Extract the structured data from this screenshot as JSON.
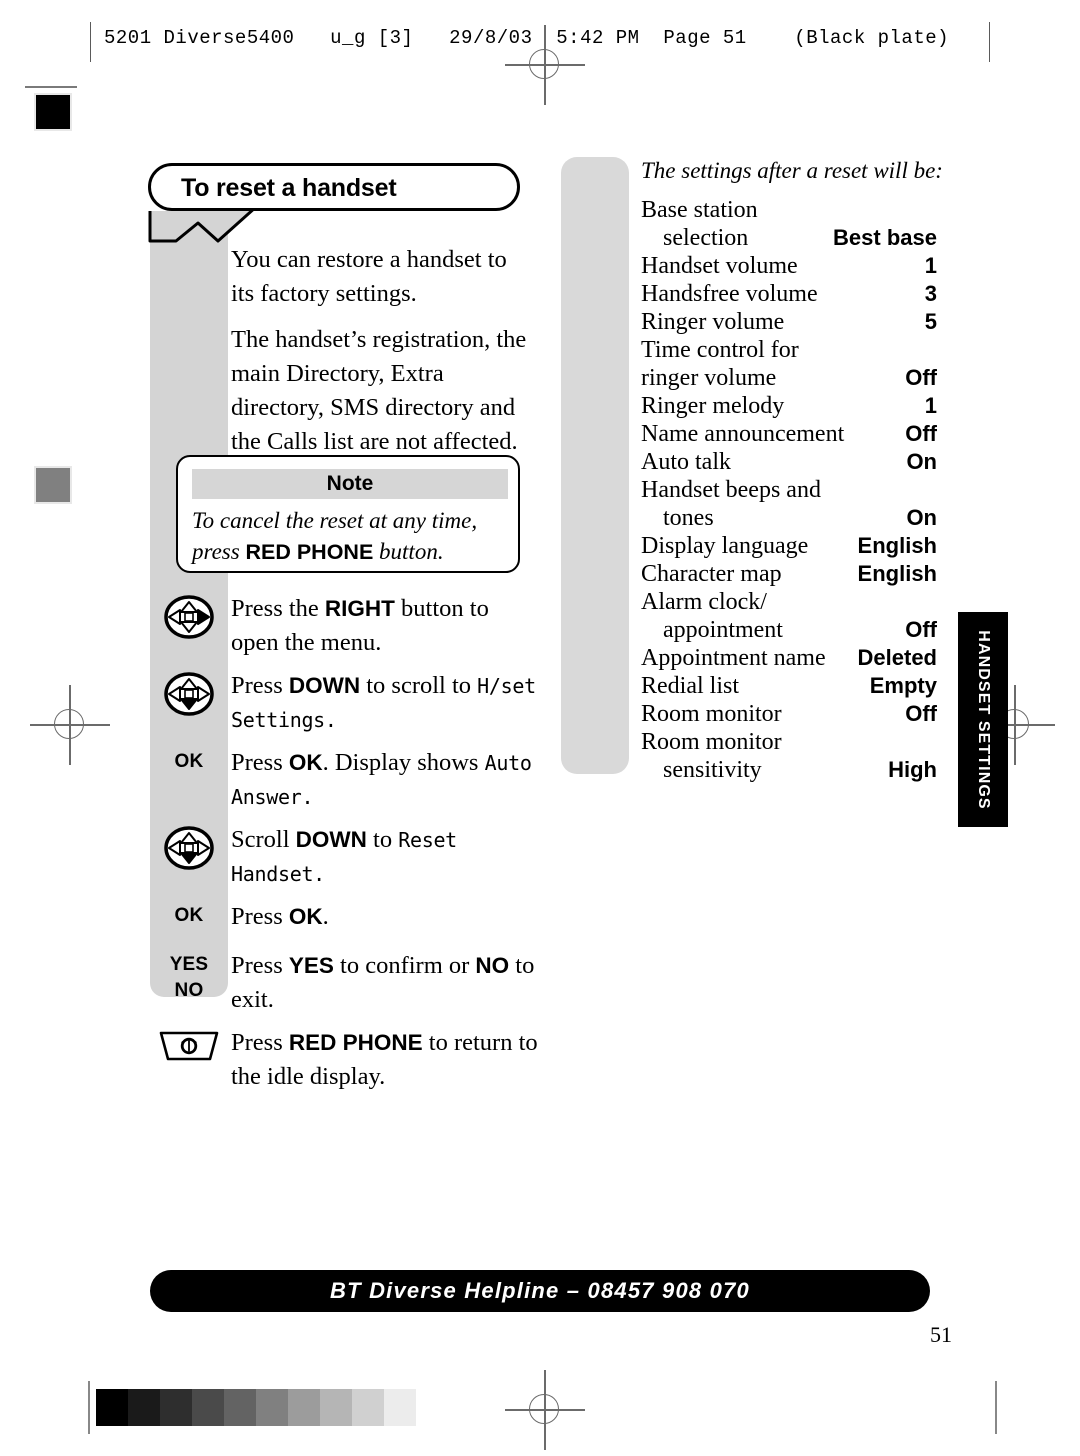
{
  "print_header": {
    "text": "5201 Diverse5400   u_g [3]   29/8/03  5:42 PM  Page 51    (Black plate)"
  },
  "title": {
    "heading": "To reset a handset"
  },
  "intro": {
    "paragraph1": "You can restore a handset to its factory settings.",
    "paragraph2": "The handset’s registration, the main Directory, Extra directory, SMS directory and the Calls list are not affected."
  },
  "note": {
    "heading": "Note",
    "line1": "To cancel the reset at any time,",
    "line2_prefix": "press ",
    "line2_bold": "RED PHONE",
    "line2_suffix": " button."
  },
  "steps": [
    {
      "icon": "nav-right-icon",
      "icon_type": "nav",
      "direction": "right",
      "text_parts": [
        {
          "t": "Press the ",
          "style": "normal"
        },
        {
          "t": "RIGHT",
          "style": "bold"
        },
        {
          "t": " button to open the menu.",
          "style": "normal"
        }
      ]
    },
    {
      "icon": "nav-down-icon",
      "icon_type": "nav",
      "direction": "down",
      "text_parts": [
        {
          "t": "Press ",
          "style": "normal"
        },
        {
          "t": "DOWN",
          "style": "bold"
        },
        {
          "t": " to scroll to ",
          "style": "normal"
        },
        {
          "t": "H/set Settings.",
          "style": "lcd"
        }
      ]
    },
    {
      "icon": "ok-key-icon",
      "icon_type": "label",
      "label": "OK",
      "text_parts": [
        {
          "t": "Press ",
          "style": "normal"
        },
        {
          "t": "OK",
          "style": "bold"
        },
        {
          "t": ". Display shows ",
          "style": "normal"
        },
        {
          "t": "Auto Answer.",
          "style": "lcd"
        }
      ]
    },
    {
      "icon": "nav-down-icon",
      "icon_type": "nav",
      "direction": "down",
      "text_parts": [
        {
          "t": "Scroll ",
          "style": "normal"
        },
        {
          "t": "DOWN",
          "style": "bold"
        },
        {
          "t": " to ",
          "style": "normal"
        },
        {
          "t": "Reset Handset.",
          "style": "lcd"
        }
      ]
    },
    {
      "icon": "ok-key-icon",
      "icon_type": "label",
      "label": "OK",
      "text_parts": [
        {
          "t": "Press ",
          "style": "normal"
        },
        {
          "t": "OK",
          "style": "bold"
        },
        {
          "t": ".",
          "style": "normal"
        }
      ]
    },
    {
      "icon": "yes-no-key-icon",
      "icon_type": "label2",
      "label": "YES",
      "label2": "NO",
      "text_parts": [
        {
          "t": "Press ",
          "style": "normal"
        },
        {
          "t": "YES",
          "style": "bold"
        },
        {
          "t": " to confirm or ",
          "style": "normal"
        },
        {
          "t": "NO",
          "style": "bold"
        },
        {
          "t": " to exit.",
          "style": "normal"
        }
      ]
    },
    {
      "icon": "red-phone-key-icon",
      "icon_type": "phone",
      "text_parts": [
        {
          "t": "Press ",
          "style": "normal"
        },
        {
          "t": "RED PHONE",
          "style": "bold"
        },
        {
          "t": " to return to the idle display.",
          "style": "normal"
        }
      ]
    }
  ],
  "settings": {
    "intro": "The settings after a reset will be:",
    "rows": [
      {
        "label": "Base station",
        "value": "",
        "indent": false
      },
      {
        "label": "selection",
        "value": "Best base",
        "indent": true
      },
      {
        "label": "Handset volume",
        "value": "1",
        "indent": false
      },
      {
        "label": "Handsfree volume",
        "value": "3",
        "indent": false
      },
      {
        "label": "Ringer volume",
        "value": "5",
        "indent": false
      },
      {
        "label": "Time control for",
        "value": "",
        "indent": false
      },
      {
        "label": "ringer volume",
        "value": "Off",
        "indent": false
      },
      {
        "label": "Ringer melody",
        "value": "1",
        "indent": false
      },
      {
        "label": "Name announcement",
        "value": "Off",
        "indent": false
      },
      {
        "label": "Auto talk",
        "value": "On",
        "indent": false
      },
      {
        "label": "Handset beeps and",
        "value": "",
        "indent": false
      },
      {
        "label": "tones",
        "value": "On",
        "indent": true
      },
      {
        "label": "Display language",
        "value": "English",
        "indent": false
      },
      {
        "label": "Character map",
        "value": "English",
        "indent": false
      },
      {
        "label": "Alarm clock/",
        "value": "",
        "indent": false
      },
      {
        "label": "appointment",
        "value": "Off",
        "indent": true
      },
      {
        "label": "Appointment name",
        "value": "Deleted",
        "indent": false
      },
      {
        "label": "Redial list",
        "value": "Empty",
        "indent": false
      },
      {
        "label": "Room monitor",
        "value": "Off",
        "indent": false
      },
      {
        "label": "Room monitor",
        "value": "",
        "indent": false
      },
      {
        "label": "sensitivity",
        "value": "High",
        "indent": true
      }
    ]
  },
  "side_tab": {
    "label": "HANDSET SETTINGS"
  },
  "footer": {
    "helpline": "BT Diverse Helpline – 08457 908 070",
    "page_number": "51"
  },
  "calibration_strip": {
    "swatches": [
      "#000000",
      "#1a1a1a",
      "#2e2e2e",
      "#4a4a4a",
      "#636363",
      "#808080",
      "#9c9c9c",
      "#b5b5b5",
      "#d0d0d0",
      "#ececec"
    ]
  }
}
